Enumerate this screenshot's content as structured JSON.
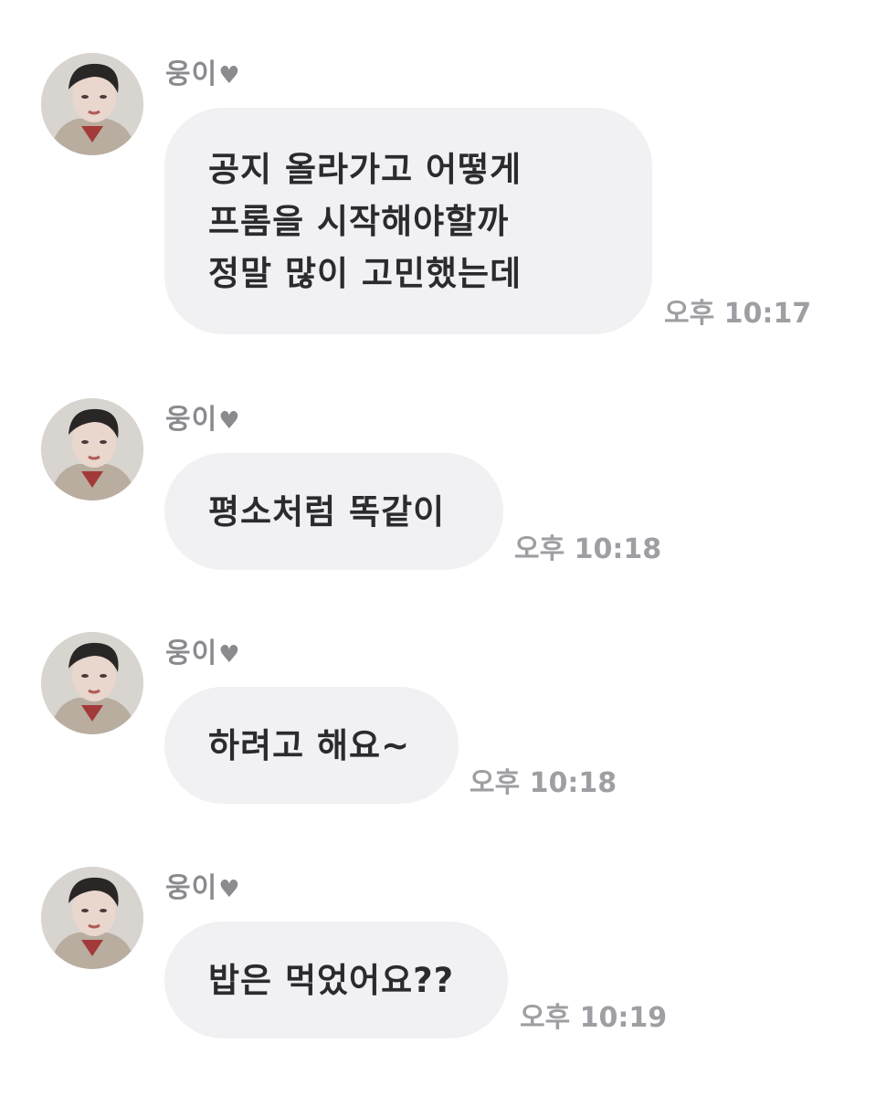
{
  "messages": [
    {
      "sender": "웅이",
      "heart_icon": "heart-icon",
      "text": "공지 올라가고 어떻게\n프롬을 시작해야할까\n정말 많이 고민했는데",
      "time": "오후 10:17"
    },
    {
      "sender": "웅이",
      "heart_icon": "heart-icon",
      "text": "평소처럼 똑같이",
      "time": "오후 10:18"
    },
    {
      "sender": "웅이",
      "heart_icon": "heart-icon",
      "text": "하려고 해요~",
      "time": "오후 10:18"
    },
    {
      "sender": "웅이",
      "heart_icon": "heart-icon",
      "text": "밥은 먹었어요??",
      "time": "오후 10:19"
    }
  ],
  "colors": {
    "bubble": "#f1f1f3",
    "text": "#2b2b2e",
    "meta": "#9e9ea3"
  }
}
